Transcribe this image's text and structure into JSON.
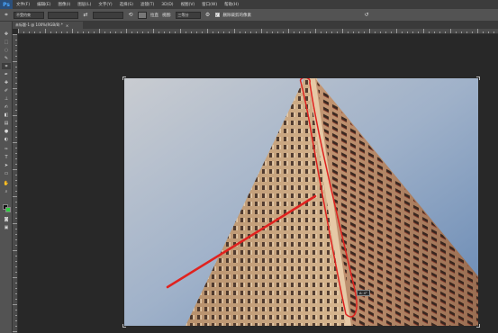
{
  "app": {
    "logo_text": "Ps"
  },
  "menu": {
    "items": [
      "文件(F)",
      "编辑(E)",
      "图像(I)",
      "图层(L)",
      "文字(Y)",
      "选择(S)",
      "滤镜(T)",
      "3D(D)",
      "视图(V)",
      "窗口(W)",
      "帮助(H)"
    ]
  },
  "options": {
    "ratio_value": "不受约束",
    "straighten_label": "拉直",
    "view_label": "视图:",
    "view_value": "三等分",
    "delete_pixels_label": "删除裁剪的像素"
  },
  "document": {
    "tab_title": "未标题-1 @ 100%(RGB/8) *",
    "close_glyph": "×"
  },
  "tooltip": {
    "text": "A: 4°"
  },
  "colors": {
    "foreground": "#111111",
    "background": "#2ecc40",
    "annotation": "#e0221f",
    "sky_top": "#6f8fb7",
    "sky_bottom": "#c8cbd0"
  }
}
